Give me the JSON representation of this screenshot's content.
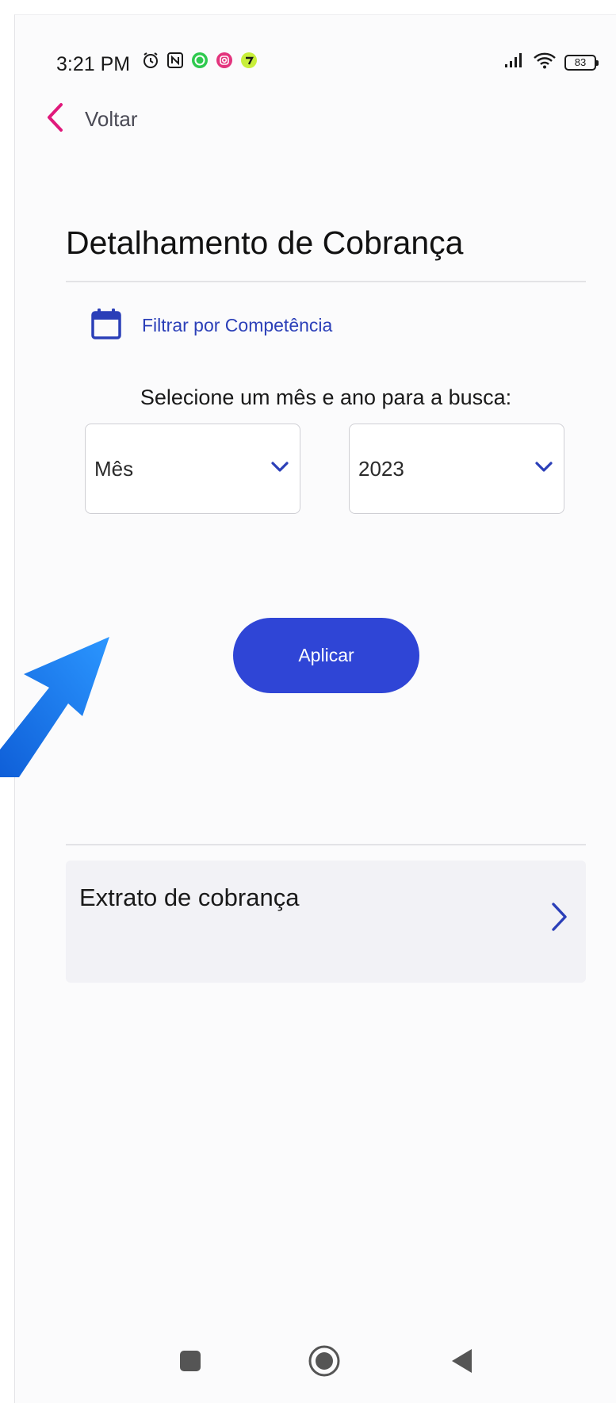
{
  "status_bar": {
    "time": "3:21 PM",
    "battery": "83",
    "icons_left": [
      "alarm-icon",
      "nfc-icon",
      "whatsapp-icon",
      "instagram-icon",
      "app-icon"
    ],
    "icons_right": [
      "signal-icon",
      "wifi-icon",
      "battery-icon"
    ]
  },
  "header": {
    "back_label": "Voltar"
  },
  "page": {
    "title": "Detalhamento de Cobrança",
    "filter_label": "Filtrar por Competência",
    "instruction": "Selecione um mês e ano para a busca:"
  },
  "filters": {
    "month_value": "Mês",
    "year_value": "2023"
  },
  "apply_button": {
    "label": "Aplicar"
  },
  "statement": {
    "label": "Extrato de cobrança"
  },
  "colors": {
    "accent": "#2f45d6",
    "link": "#2b3fb8",
    "back_chevron": "#e0197b",
    "annotation_arrow": "#1a7cf0",
    "background": "#fbfbfc",
    "card": "#f2f2f6"
  }
}
